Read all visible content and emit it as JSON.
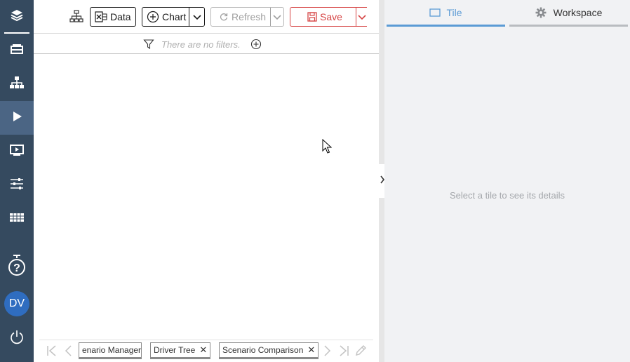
{
  "rail": {
    "items": [
      {
        "icon": "stack-icon"
      },
      {
        "icon": "inbox-icon"
      },
      {
        "icon": "hierarchy-icon"
      },
      {
        "icon": "play-icon",
        "active": true
      },
      {
        "icon": "monitor-play-icon"
      },
      {
        "icon": "sliders-icon"
      },
      {
        "icon": "table-icon"
      },
      {
        "icon": "help-icon"
      },
      {
        "icon": "power-icon"
      }
    ],
    "avatar_initials": "DV"
  },
  "toolbar": {
    "data_label": "Data",
    "chart_label": "Chart",
    "refresh_label": "Refresh",
    "save_label": "Save"
  },
  "filter_bar": {
    "empty_text": "There are no filters."
  },
  "page_tabs": [
    {
      "label": "enario Manager",
      "closable": false
    },
    {
      "label": "Driver Tree",
      "closable": true
    },
    {
      "label": "Scenario Comparison",
      "closable": true
    }
  ],
  "right_panel": {
    "tabs": [
      {
        "label": "Tile",
        "active": true
      },
      {
        "label": "Workspace",
        "active": false
      }
    ],
    "empty_message": "Select a tile to see its details"
  },
  "colors": {
    "rail_bg": "#354a5f",
    "rail_active": "#4b6584",
    "accent": "#5b9bd5",
    "save": "#d64545",
    "avatar": "#2f6dc0"
  }
}
